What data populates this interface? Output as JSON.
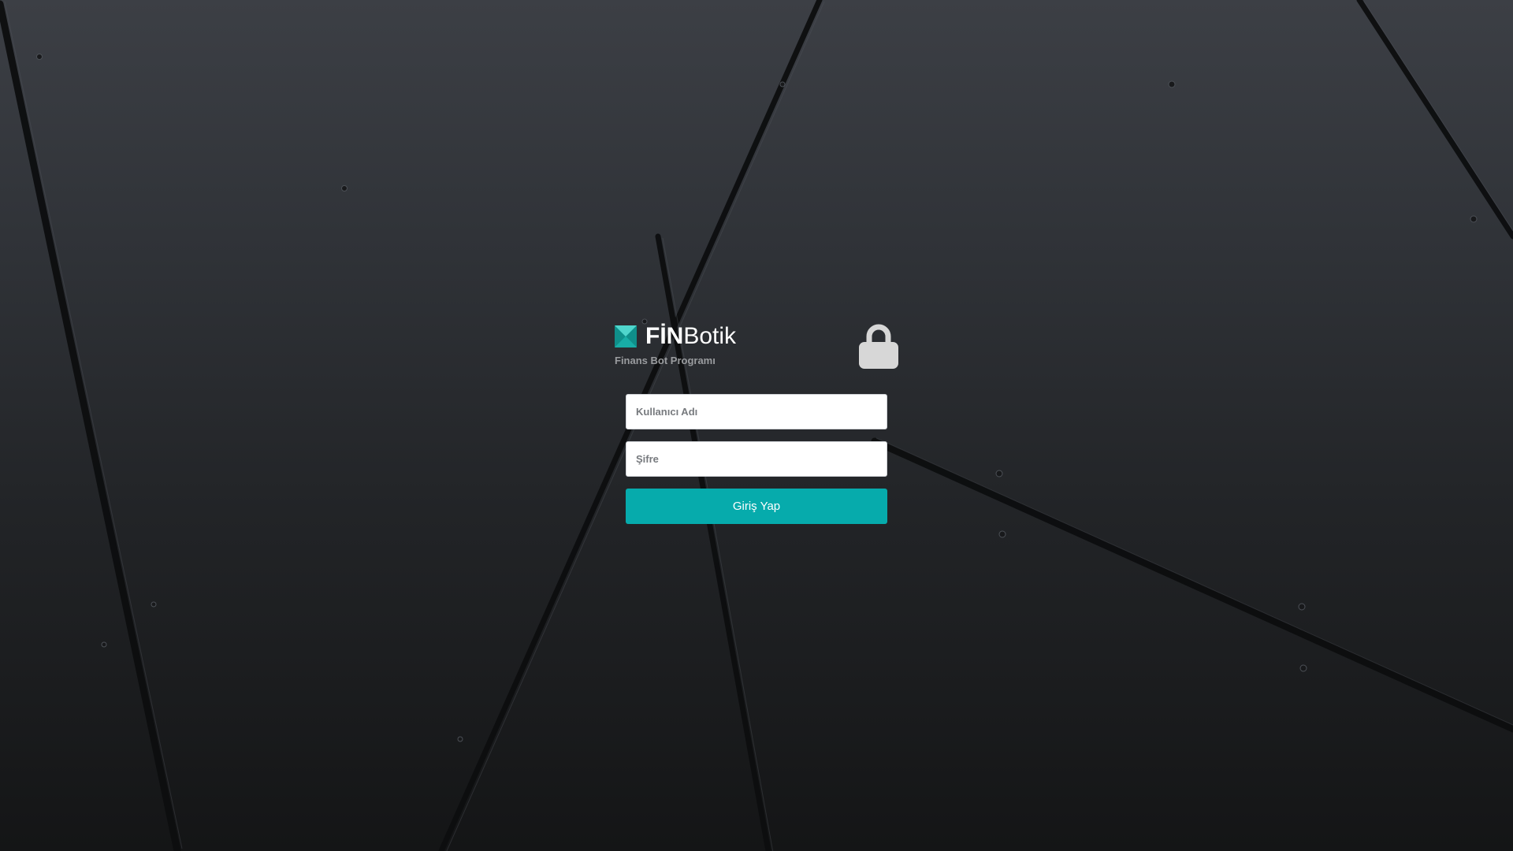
{
  "brand": {
    "name_bold": "FİN",
    "name_regular": "Botik",
    "tagline": "Finans Bot Programı",
    "logo_icon": "finbotik-logo-icon",
    "accent_color": "#06abac"
  },
  "lock_icon": "lock-icon",
  "form": {
    "username_placeholder": "Kullanıcı Adı",
    "password_placeholder": "Şifre",
    "submit_label": "Giriş Yap"
  }
}
